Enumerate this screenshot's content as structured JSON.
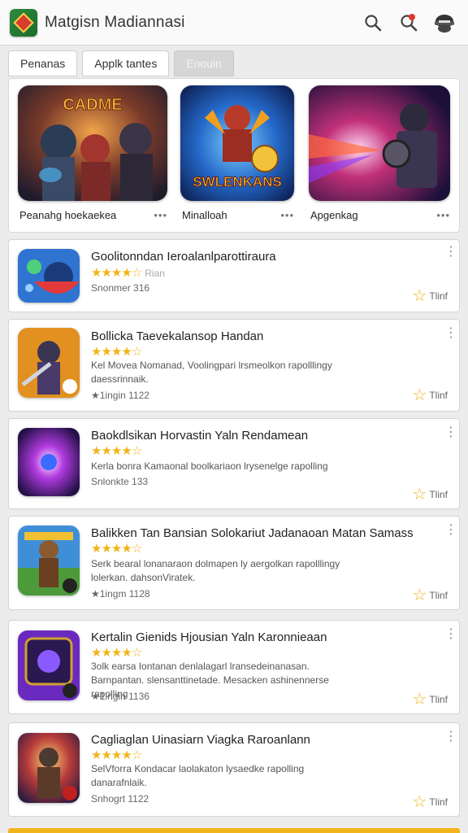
{
  "app": {
    "title": "Matgisn Madiannasi"
  },
  "topbar": {
    "icons": [
      "search-icon",
      "search-alert-icon",
      "avatar-icon"
    ]
  },
  "tabs": [
    {
      "label": "Penanas"
    },
    {
      "label": "Applk tantes"
    },
    {
      "label": "Enouin"
    }
  ],
  "featured": [
    {
      "art_text": "CADME",
      "caption": "Peanahg hoekaekea",
      "more": "•••"
    },
    {
      "art_text": "SWLENKANS",
      "caption": "Minalloah",
      "more": "•••"
    },
    {
      "art_text": "",
      "caption": "Apgenkag",
      "more": "•••"
    }
  ],
  "apps": [
    {
      "title": "Goolitonndan Ieroalanlparottiraura",
      "stars": "★★★★☆",
      "stars_extra": "Rian",
      "desc": "",
      "meta": "Snonmer 316",
      "rating": "Tlinf",
      "more": "⋮"
    },
    {
      "title": "Bollicka Taevekalansop Handan",
      "stars": "★★★★☆",
      "stars_extra": "",
      "desc": "Kel Movea Nomanad, Voolingpari lrsmeolkon rapolllingy daessrinnaik.",
      "meta": "★1ingin 1122",
      "rating": "Tlinf",
      "more": "⋮"
    },
    {
      "title": "Baokdlsikan Horvastin Yaln Rendamean",
      "stars": "★★★★☆",
      "stars_extra": "",
      "desc": "Kerla bonra Kamaonal boolkariaon lrysenelge rapolling",
      "meta": "Snlonkte 133",
      "rating": "Tlinf",
      "more": "⋮"
    },
    {
      "title": "Balikken Tan Bansian Solokariut Jadanaoan Matan Samass",
      "stars": "★★★★☆",
      "stars_extra": "",
      "desc": "Serk bearal lonanaraon dolmapen ly aergolkan rapolllingy lolerkan. dahsonViratek.",
      "meta": "★1ingm 1128",
      "rating": "Tlinf",
      "more": "⋮"
    },
    {
      "title": "Kertalin Gienids Hjousian Yaln Karonnieaan",
      "stars": "★★★★☆",
      "stars_extra": "",
      "desc": "3olk earsa Iontanan denlalagarl lransedeinanasan. Barnpantan. slensanttinetade. Mesacken ashinennerse rapolling",
      "meta": "★1ingin 1136",
      "rating": "Tlinf",
      "more": "⋮"
    },
    {
      "title": "Cagliaglan Uinasiarn Viagka Raroanlann",
      "stars": "★★★★☆",
      "stars_extra": "",
      "desc": "SelVforra Kondacar laolakaton lysaedke rapolling danarafnlaik.",
      "meta": "Snhogrt 1122",
      "rating": "Tlinf",
      "more": "⋮"
    }
  ],
  "colors": {
    "star": "#f1b419",
    "card_bg": "#ffffff",
    "page_bg": "#ececec"
  }
}
